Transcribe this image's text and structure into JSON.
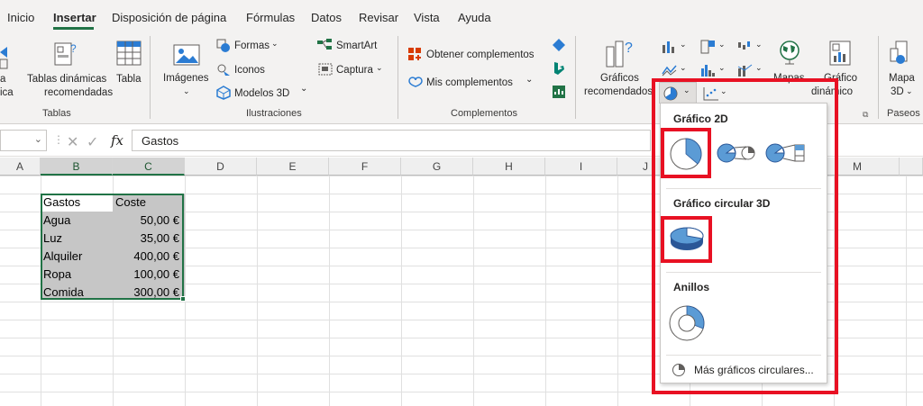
{
  "tabs": [
    "Inicio",
    "Insertar",
    "Disposición de página",
    "Fórmulas",
    "Datos",
    "Revisar",
    "Vista",
    "Ayuda"
  ],
  "ribbon": {
    "tablas": {
      "left_partial": "a",
      "left_partial2": "ica",
      "tablas_dinamicas_rec_1": "Tablas dinámicas",
      "tablas_dinamicas_rec_2": "recomendadas",
      "tabla": "Tabla",
      "group": "Tablas"
    },
    "ilustraciones": {
      "imagenes": "Imágenes",
      "formas": "Formas",
      "iconos": "Iconos",
      "modelos3d": "Modelos 3D",
      "smartart": "SmartArt",
      "captura": "Captura",
      "group": "Ilustraciones"
    },
    "complementos": {
      "obtener": "Obtener complementos",
      "mis": "Mis complementos",
      "group": "Complementos"
    },
    "graficos": {
      "rec_1": "Gráficos",
      "rec_2": "recomendados",
      "mapas": "Mapas",
      "dinamico_1": "Gráfico",
      "dinamico_2": "dinámico"
    },
    "paseos": {
      "mapa_1": "Mapa",
      "mapa_2": "3D",
      "group": "Paseos"
    }
  },
  "formula_bar": {
    "value": "Gastos",
    "fx": "fx"
  },
  "columns": [
    "A",
    "B",
    "C",
    "D",
    "E",
    "F",
    "G",
    "H",
    "I",
    "J",
    "M"
  ],
  "sheet": {
    "header": [
      "Gastos",
      "Coste"
    ],
    "rows": [
      [
        "Agua",
        "50,00 €"
      ],
      [
        "Luz",
        "35,00 €"
      ],
      [
        "Alquiler",
        "400,00 €"
      ],
      [
        "Ropa",
        "100,00 €"
      ],
      [
        "Comida",
        "300,00 €"
      ]
    ]
  },
  "dropdown": {
    "section_2d": "Gráfico 2D",
    "section_3d": "Gráfico circular 3D",
    "section_rings": "Anillos",
    "more": "Más gráficos circulares..."
  },
  "colors": {
    "accent": "#217346",
    "highlight": "#e81123",
    "chart_blue": "#5b9bd5"
  }
}
